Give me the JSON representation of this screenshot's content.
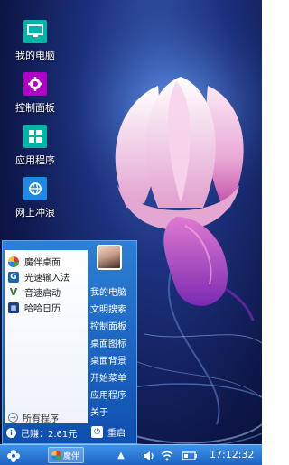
{
  "desktop": {
    "icons": [
      {
        "label": "我的电脑",
        "icon": "monitor-icon",
        "color": "#00b4a8"
      },
      {
        "label": "控制面板",
        "icon": "gear-icon",
        "color": "#b000c8"
      },
      {
        "label": "应用程序",
        "icon": "grid-icon",
        "color": "#00b4a8"
      },
      {
        "label": "网上冲浪",
        "icon": "globe-icon",
        "color": "#1e88e5"
      }
    ]
  },
  "start_menu": {
    "programs": [
      {
        "label": "魔伴桌面",
        "icon": "pinwheel-icon"
      },
      {
        "label": "光速输入法",
        "icon": "input-method-icon"
      },
      {
        "label": "音速启动",
        "icon": "v-launcher-icon"
      },
      {
        "label": "哈哈日历",
        "icon": "calendar-icon"
      }
    ],
    "all_programs": "所有程序",
    "links": [
      "我的电脑",
      "文明搜索",
      "控制面板",
      "桌面图标",
      "桌面背景",
      "开始菜单",
      "应用程序",
      "关于"
    ],
    "earned": "已赚：2.61元",
    "restart": "重启"
  },
  "taskbar": {
    "task_label": "魔伴",
    "clock": "17:12:32"
  },
  "colors": {
    "taskbar": "#1c63c3",
    "start_menu": "#1a6cc9",
    "accent": "#00b4a8"
  }
}
